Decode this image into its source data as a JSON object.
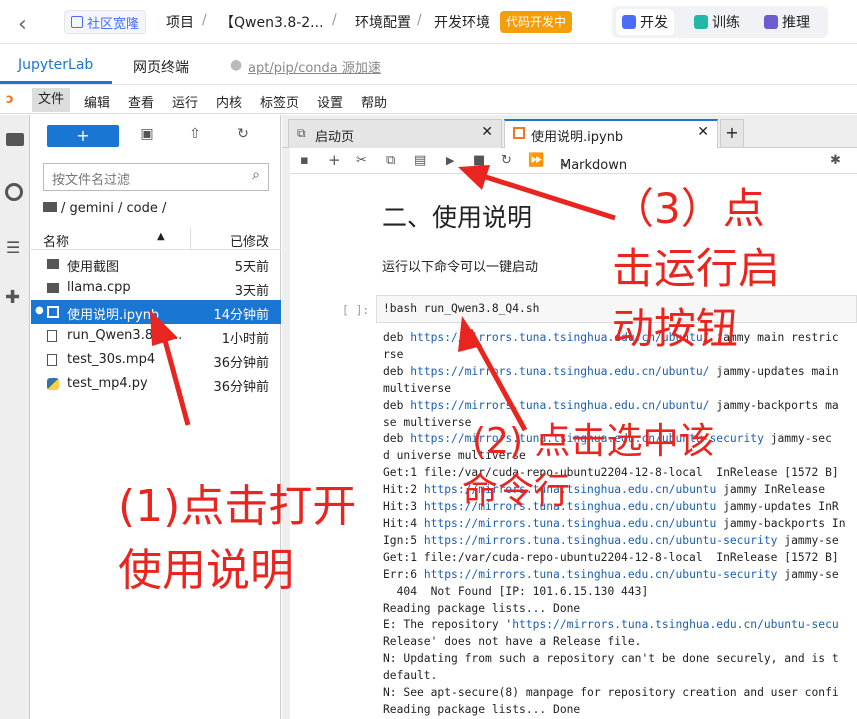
{
  "topbar": {
    "community": "社区宽隆",
    "project": "项目",
    "repo": "【Qwen3.8-2...",
    "env": "环境配置",
    "dev_env": "开发环境",
    "badge": "代码开发中",
    "modes": [
      "开发",
      "训练",
      "推理"
    ]
  },
  "tabs2": {
    "jupyter": "JupyterLab",
    "terminal": "网页终端",
    "mirror": "apt/pip/conda 源加速"
  },
  "menu": [
    "文件",
    "编辑",
    "查看",
    "运行",
    "内核",
    "标签页",
    "设置",
    "帮助"
  ],
  "filebrowser": {
    "filter_placeholder": "按文件名过滤",
    "path": "/ gemini / code /",
    "col_name": "名称",
    "col_modified": "已修改",
    "files": [
      {
        "name": "使用截图",
        "date": "5天前"
      },
      {
        "name": "llama.cpp",
        "date": "3天前"
      },
      {
        "name": "使用说明.ipynb",
        "date": "14分钟前"
      },
      {
        "name": "run_Qwen3.8_Q...",
        "date": "1小时前"
      },
      {
        "name": "test_30s.mp4",
        "date": "36分钟前"
      },
      {
        "name": "test_mp4.py",
        "date": "36分钟前"
      }
    ]
  },
  "doctabs": {
    "launcher": "启动页",
    "notebook": "使用说明.ipynb"
  },
  "toolbar": {
    "celltype": "Markdown"
  },
  "notebook": {
    "heading": "二、使用说明",
    "intro": "运行以下命令可以一键启动",
    "prompt": "[ ]:",
    "cell_code": "!bash run_Qwen3.8_Q4.sh",
    "output": [
      [
        "deb ",
        "https://mirrors.tuna.tsinghua.edu.cn/ubuntu/",
        " jammy main restric"
      ],
      [
        "rse",
        "",
        ""
      ],
      [
        "deb ",
        "https://mirrors.tuna.tsinghua.edu.cn/ubuntu/",
        " jammy-updates main"
      ],
      [
        "multiverse",
        "",
        ""
      ],
      [
        "deb ",
        "https://mirrors.tuna.tsinghua.edu.cn/ubuntu/",
        " jammy-backports ma"
      ],
      [
        "se multiverse",
        "",
        ""
      ],
      [
        "deb ",
        "https://mirrors.tuna.tsinghua.edu.cn/ubuntu-security",
        " jammy-sec"
      ],
      [
        "d universe multiverse",
        "",
        ""
      ],
      [
        "Get:1 file:/var/cuda-repo-ubuntu2204-12-8-local  InRelease [1572 B]",
        "",
        ""
      ],
      [
        "Hit:2 ",
        "https://mirrors.tuna.tsinghua.edu.cn/ubuntu",
        " jammy InRelease"
      ],
      [
        "Hit:3 ",
        "https://mirrors.tuna.tsinghua.edu.cn/ubuntu",
        " jammy-updates InR"
      ],
      [
        "Hit:4 ",
        "https://mirrors.tuna.tsinghua.edu.cn/ubuntu",
        " jammy-backports In"
      ],
      [
        "Ign:5 ",
        "https://mirrors.tuna.tsinghua.edu.cn/ubuntu-security",
        " jammy-se"
      ],
      [
        "Get:1 file:/var/cuda-repo-ubuntu2204-12-8-local  InRelease [1572 B]",
        "",
        ""
      ],
      [
        "Err:6 ",
        "https://mirrors.tuna.tsinghua.edu.cn/ubuntu-security",
        " jammy-se"
      ],
      [
        "  404  Not Found [IP: 101.6.15.130 443]",
        "",
        ""
      ],
      [
        "Reading package lists... Done",
        "",
        ""
      ],
      [
        "E: The repository '",
        "https://mirrors.tuna.tsinghua.edu.cn/ubuntu-secu",
        ""
      ],
      [
        "Release' does not have a Release file.",
        "",
        ""
      ],
      [
        "N: Updating from such a repository can't be done securely, and is t",
        "",
        ""
      ],
      [
        "default.",
        "",
        ""
      ],
      [
        "N: See apt-secure(8) manpage for repository creation and user confi",
        "",
        ""
      ],
      [
        "Reading package lists... Done",
        "",
        ""
      ]
    ]
  },
  "annotations": {
    "a1_line1": "(1)点击打开",
    "a1_line2": "使用说明",
    "a2_line1": "(2) 点击选中该",
    "a2_line2": "命令行",
    "a3_line1": "（3）点",
    "a3_line2": "击运行启",
    "a3_line3": "动按钮"
  },
  "colors": {
    "accent": "#1976d2",
    "annotation": "#e8251f",
    "badge": "#f59e0b"
  }
}
